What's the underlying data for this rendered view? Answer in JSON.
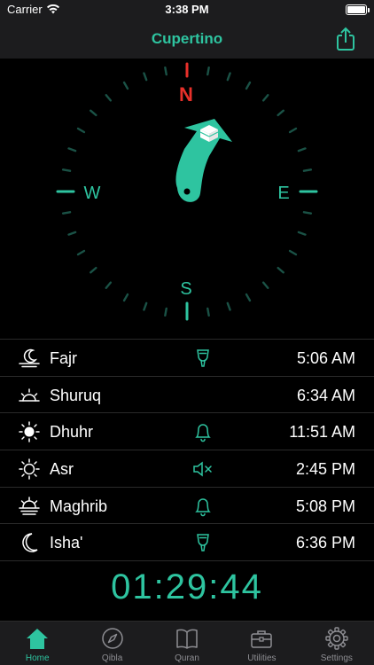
{
  "status_bar": {
    "carrier": "Carrier",
    "time": "3:38 PM"
  },
  "header": {
    "title": "Cupertino"
  },
  "compass": {
    "north": "N",
    "south": "S",
    "east": "E",
    "west": "W",
    "accent": "#2ec4a0",
    "north_color": "#e8302a"
  },
  "prayers": [
    {
      "name": "Fajr",
      "time": "5:06 AM",
      "icon": "sunrise-low-icon",
      "alert": "speaker-horn-icon"
    },
    {
      "name": "Shuruq",
      "time": "6:34 AM",
      "icon": "sunrise-icon",
      "alert": ""
    },
    {
      "name": "Dhuhr",
      "time": "11:51 AM",
      "icon": "sun-icon",
      "alert": "bell-icon"
    },
    {
      "name": "Asr",
      "time": "2:45 PM",
      "icon": "sun-outline-icon",
      "alert": "mute-icon"
    },
    {
      "name": "Maghrib",
      "time": "5:08 PM",
      "icon": "sunset-icon",
      "alert": "bell-icon"
    },
    {
      "name": "Isha'",
      "time": "6:36 PM",
      "icon": "moon-icon",
      "alert": "speaker-horn-icon"
    }
  ],
  "countdown": "01:29:44",
  "tabs": [
    {
      "label": "Home",
      "icon": "home-icon",
      "active": true
    },
    {
      "label": "Qibla",
      "icon": "compass-icon",
      "active": false
    },
    {
      "label": "Quran",
      "icon": "book-icon",
      "active": false
    },
    {
      "label": "Utilities",
      "icon": "toolbox-icon",
      "active": false
    },
    {
      "label": "Settings",
      "icon": "gear-icon",
      "active": false
    }
  ]
}
